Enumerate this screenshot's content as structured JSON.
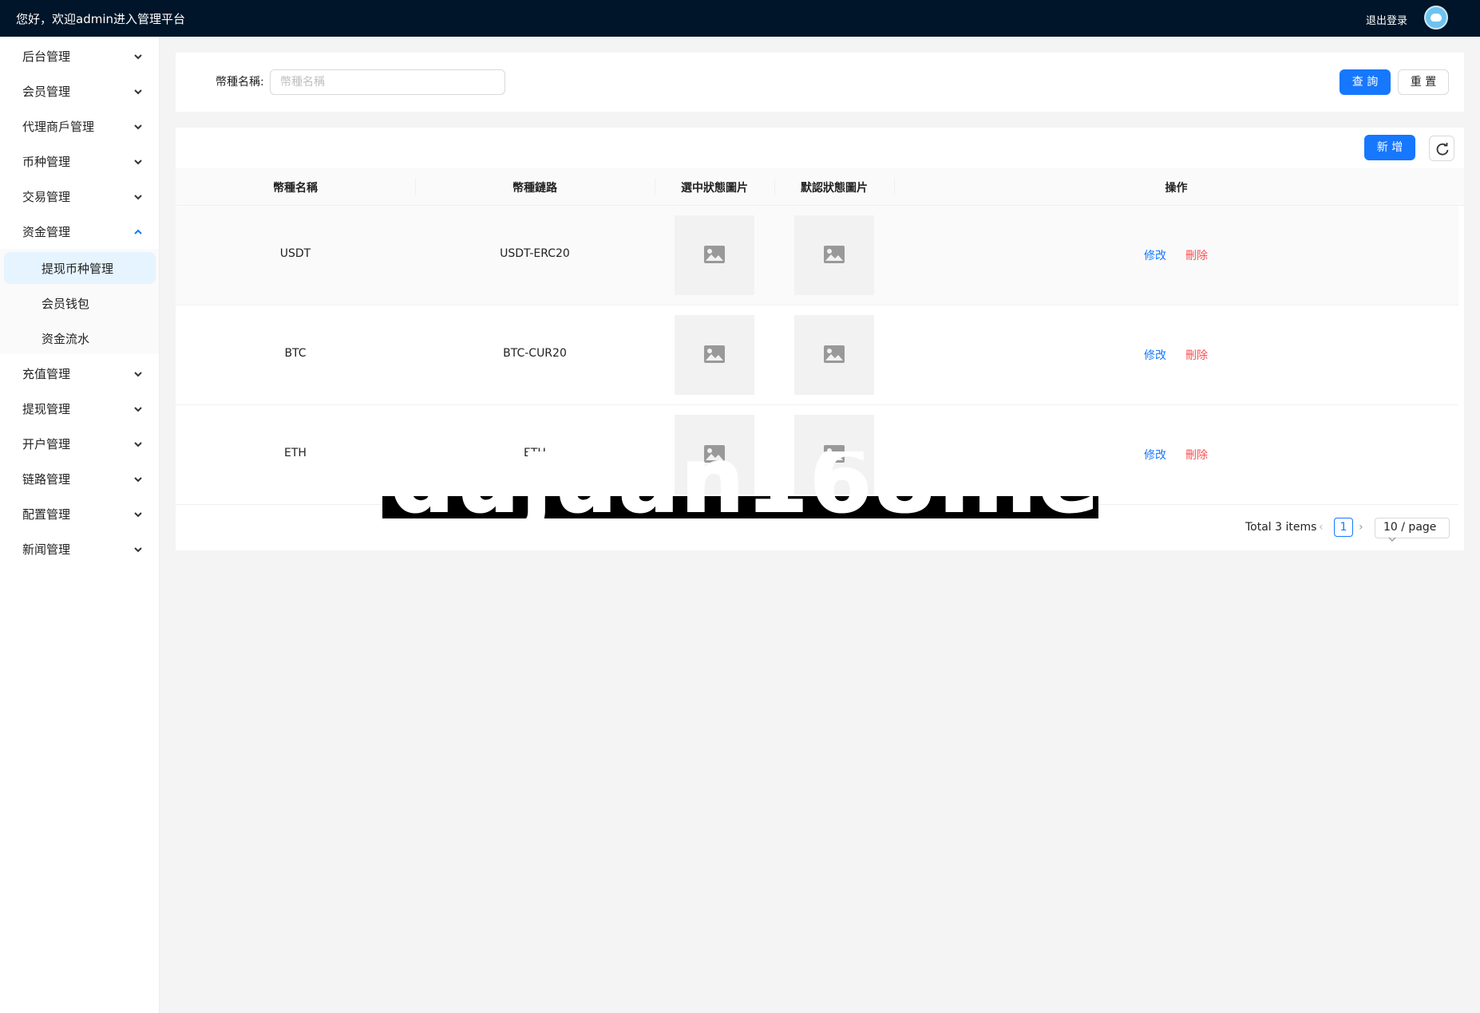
{
  "header": {
    "welcome": "您好，欢迎admin进入管理平台",
    "logout": "退出登录",
    "avatar_icon": "avatar-icon"
  },
  "sidebar": {
    "items": [
      {
        "label": "后台管理",
        "expanded": false
      },
      {
        "label": "会员管理",
        "expanded": false
      },
      {
        "label": "代理商戶管理",
        "expanded": false
      },
      {
        "label": "币种管理",
        "expanded": false
      },
      {
        "label": "交易管理",
        "expanded": false
      },
      {
        "label": "资金管理",
        "expanded": true
      },
      {
        "label": "充值管理",
        "expanded": false
      },
      {
        "label": "提现管理",
        "expanded": false
      },
      {
        "label": "开户管理",
        "expanded": false
      },
      {
        "label": "链路管理",
        "expanded": false
      },
      {
        "label": "配置管理",
        "expanded": false
      },
      {
        "label": "新闻管理",
        "expanded": false
      }
    ],
    "subitems": [
      {
        "label": "提现币种管理",
        "active": true
      },
      {
        "label": "会员钱包",
        "active": false
      },
      {
        "label": "资金流水",
        "active": false
      }
    ]
  },
  "search": {
    "label": "幣種名稱:",
    "placeholder": "幣種名稱",
    "value": "",
    "query_btn": "查 詢",
    "reset_btn": "重 置"
  },
  "table": {
    "add_btn": "新 增",
    "columns": [
      "幣種名稱",
      "幣種鏈路",
      "選中狀態圖片",
      "默認狀態圖片",
      "操作"
    ],
    "rows": [
      {
        "name": "USDT",
        "chain": "USDT-ERC20",
        "edit": "修改",
        "delete": "刪除"
      },
      {
        "name": "BTC",
        "chain": "BTC-CUR20",
        "edit": "修改",
        "delete": "刪除"
      },
      {
        "name": "ETH",
        "chain": "ETH",
        "edit": "修改",
        "delete": "刪除"
      }
    ]
  },
  "pagination": {
    "total": "Total 3 items",
    "current": "1",
    "page_size": "10 / page"
  },
  "watermark": "dujuan168.net",
  "colors": {
    "header_bg": "#001529",
    "primary": "#1677ff",
    "danger": "#ff4d4f",
    "active_bg": "#e6f4ff"
  }
}
